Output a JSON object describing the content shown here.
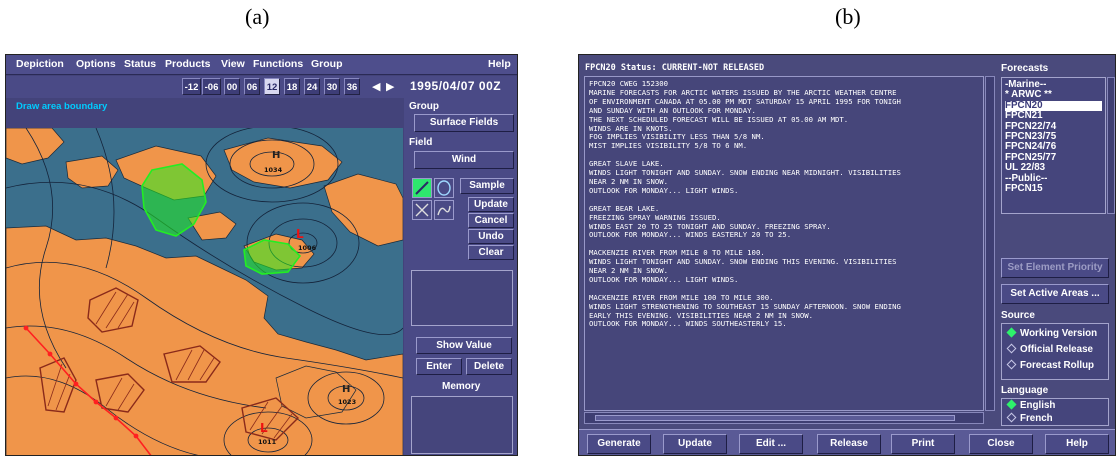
{
  "captions": {
    "a": "(a)",
    "b": "(b)"
  },
  "panel_a": {
    "menu": [
      "Depiction",
      "Options",
      "Status",
      "Products",
      "View",
      "Functions",
      "Group",
      "Help"
    ],
    "time_buttons": [
      "-12",
      "-06",
      "00",
      "06",
      "12",
      "18",
      "24",
      "30",
      "36"
    ],
    "active_time": "12",
    "date": "1995/04/07 00Z",
    "status_message": "Draw area boundary",
    "group_label": "Group",
    "group_value": "Surface Fields",
    "field_label": "Field",
    "field_value": "Wind",
    "tool_buttons": [
      "Sample",
      "Update",
      "Cancel",
      "Undo",
      "Clear"
    ],
    "show_value": "Show Value",
    "enter": "Enter",
    "delete": "Delete",
    "memory_label": "Memory",
    "map_labels": [
      "1034",
      "1006",
      "1023",
      "1011"
    ],
    "colors": {
      "land": "#f0954a",
      "water": "#3b6f8c",
      "area": "#22ee22",
      "front": "#ff0000"
    }
  },
  "panel_b": {
    "title": "FPCN20   Status: CURRENT-NOT RELEASED",
    "text_lines": [
      "FPCN20 CWEG 152300",
      "MARINE FORECASTS FOR ARCTIC WATERS ISSUED BY THE ARCTIC WEATHER CENTRE",
      "OF ENVIRONMENT CANADA AT 05.00 PM MDT SATURDAY 15 APRIL 1995 FOR TONIGH",
      "AND SUNDAY WITH AN OUTLOOK FOR MONDAY.",
      "THE NEXT SCHEDULED FORECAST WILL BE ISSUED AT 05.00 AM MDT.",
      "WINDS ARE IN KNOTS.",
      "FOG IMPLIES VISIBILITY LESS THAN 5/8 NM.",
      "MIST IMPLIES VISIBILITY 5/8 TO 6 NM.",
      "",
      "GREAT SLAVE LAKE.",
      "WINDS LIGHT TONIGHT AND SUNDAY. SNOW ENDING NEAR MIDNIGHT. VISIBILITIES",
      "NEAR 2 NM IN SNOW.",
      "OUTLOOK FOR MONDAY... LIGHT WINDS.",
      "",
      "GREAT BEAR LAKE.",
      "FREEZING SPRAY WARNING ISSUED.",
      "WINDS EAST 20 TO 25 TONIGHT AND SUNDAY. FREEZING SPRAY.",
      "OUTLOOK FOR MONDAY... WINDS EASTERLY 20 TO 25.",
      "",
      "MACKENZIE RIVER FROM MILE 0 TO MILE 100.",
      "WINDS LIGHT TONIGHT AND SUNDAY. SNOW ENDING THIS EVENING. VISIBILITIES",
      "NEAR 2 NM IN SNOW.",
      "OUTLOOK FOR MONDAY... LIGHT WINDS.",
      "",
      "MACKENZIE RIVER FROM MILE 100 TO MILE 300.",
      "WINDS LIGHT STRENGTHENING TO SOUTHEAST 15 SUNDAY AFTERNOON. SNOW ENDING",
      "EARLY THIS EVENING. VISIBILITIES NEAR 2 NM IN SNOW.",
      "OUTLOOK FOR MONDAY... WINDS SOUTHEASTERLY 15."
    ],
    "forecasts_label": "Forecasts",
    "forecasts": [
      "-Marine--",
      "* ARWC **",
      "FPCN20",
      "FPCN21",
      "FPCN22/74",
      "FPCN23/75",
      "FPCN24/76",
      "FPCN25/77",
      "UL 22/83",
      "--Public--",
      "FPCN15"
    ],
    "selected_forecast": "FPCN20",
    "set_element_priority": "Set Element Priority ...",
    "set_active_areas": "Set Active Areas ...",
    "source_label": "Source",
    "sources": [
      "Working Version",
      "Official Release",
      "Forecast Rollup"
    ],
    "language_label": "Language",
    "languages": [
      "English",
      "French"
    ],
    "bottom_buttons": [
      "Generate",
      "Update",
      "Edit ...",
      "Release",
      "Print",
      "Close",
      "Help"
    ]
  }
}
